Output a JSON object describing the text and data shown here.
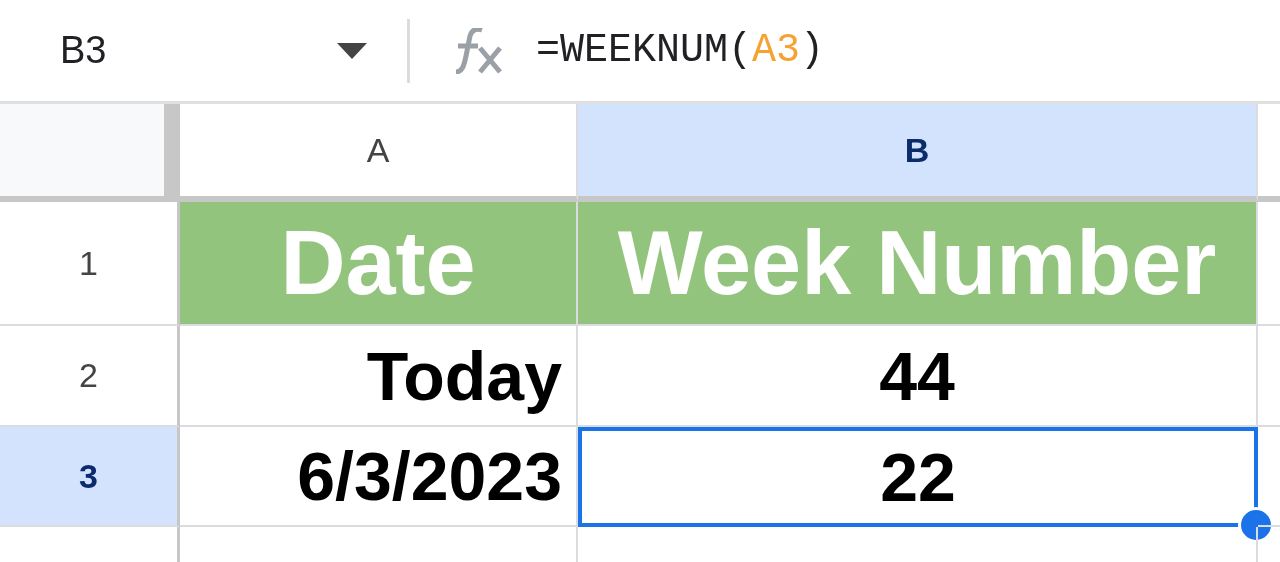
{
  "name_box": {
    "value": "B3"
  },
  "formula_bar": {
    "parts": [
      {
        "text": "=WEEKNUM(",
        "kind": "plain"
      },
      {
        "text": "A3",
        "kind": "reference"
      },
      {
        "text": ")",
        "kind": "plain"
      }
    ]
  },
  "columns": [
    {
      "label": "A",
      "selected": false
    },
    {
      "label": "B",
      "selected": true
    }
  ],
  "rows": [
    {
      "label": "1",
      "selected": false,
      "kind": "header",
      "cells": [
        {
          "text": "Date",
          "kind": "heading",
          "selected": false
        },
        {
          "text": "Week Number",
          "kind": "heading",
          "selected": false
        }
      ]
    },
    {
      "label": "2",
      "selected": false,
      "kind": "data",
      "cells": [
        {
          "text": "Today",
          "kind": "text",
          "selected": false
        },
        {
          "text": "44",
          "kind": "number",
          "selected": false
        }
      ]
    },
    {
      "label": "3",
      "selected": true,
      "kind": "data",
      "cells": [
        {
          "text": "6/3/2023",
          "kind": "text",
          "selected": false
        },
        {
          "text": "22",
          "kind": "number",
          "selected": true
        }
      ]
    }
  ]
}
